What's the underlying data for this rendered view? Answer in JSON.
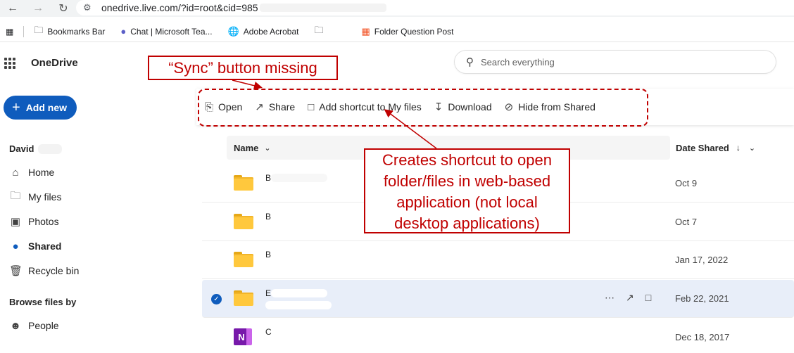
{
  "browser": {
    "url": "onedrive.live.com/?id=root&cid=985",
    "bookmarks": [
      {
        "label": "Bookmarks Bar",
        "icon": "folder-icon"
      },
      {
        "label": "Chat | Microsoft Tea...",
        "icon": "teams-icon"
      },
      {
        "label": "Adobe Acrobat",
        "icon": "globe-icon"
      },
      {
        "label": "",
        "icon": "folder-icon"
      },
      {
        "label": "Folder Question Post",
        "icon": "windows-icon"
      }
    ]
  },
  "app": {
    "name": "OneDrive",
    "add_new": "Add new",
    "user_name": "David",
    "search_placeholder": "Search everything",
    "nav": [
      {
        "label": "Home",
        "icon": "home-icon"
      },
      {
        "label": "My files",
        "icon": "folder-icon"
      },
      {
        "label": "Photos",
        "icon": "image-icon"
      },
      {
        "label": "Shared",
        "icon": "people-icon",
        "active": true
      },
      {
        "label": "Recycle bin",
        "icon": "trash-icon"
      }
    ],
    "browse_heading": "Browse files by",
    "browse": [
      {
        "label": "People",
        "icon": "person-icon"
      }
    ]
  },
  "commands": [
    {
      "label": "Open",
      "icon": "open-icon"
    },
    {
      "label": "Share",
      "icon": "share-icon"
    },
    {
      "label": "Add shortcut to My files",
      "icon": "shortcut-icon"
    },
    {
      "label": "Download",
      "icon": "download-icon"
    },
    {
      "label": "Hide from Shared",
      "icon": "hide-icon"
    }
  ],
  "table": {
    "col_name": "Name",
    "col_date": "Date Shared",
    "rows": [
      {
        "name": "B",
        "date": "Oct 9",
        "type": "folder"
      },
      {
        "name": "B",
        "date": "Oct 7",
        "type": "folder"
      },
      {
        "name": "B",
        "date": "Jan 17, 2022",
        "type": "folder"
      },
      {
        "name": "E",
        "date": "Feb 22, 2021",
        "type": "folder",
        "selected": true
      },
      {
        "name": "C",
        "date": "Dec 18, 2017",
        "type": "onenote"
      }
    ]
  },
  "annotations": {
    "sync_missing": "“Sync” button missing",
    "shortcut_note_lines": [
      "Creates shortcut to open",
      "folder/files in web-based",
      "application (not local",
      "desktop applications)"
    ],
    "color": "#c00000"
  },
  "colors": {
    "accent": "#0f5cbd",
    "folder": "#ffc83d"
  }
}
